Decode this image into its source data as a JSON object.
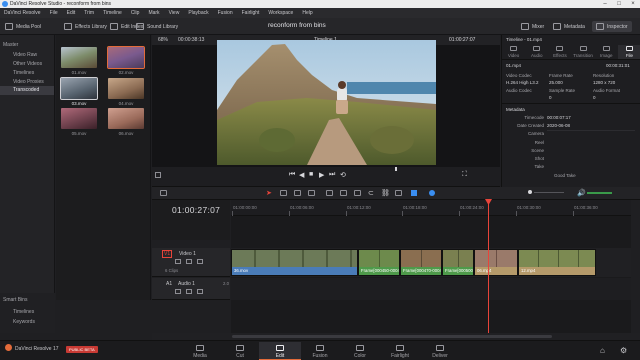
{
  "window": {
    "title": "DaVinci Resolve Studio - reconform from bins"
  },
  "menu": [
    "DaVinci Resolve",
    "File",
    "Edit",
    "Trim",
    "Timeline",
    "Clip",
    "Mark",
    "View",
    "Playback",
    "Fusion",
    "Fairlight",
    "Workspace",
    "Help"
  ],
  "toolbar": {
    "media_pool": "Media Pool",
    "effects_library": "Effects Library",
    "edit_index": "Edit Index",
    "sound_library": "Sound Library",
    "project_title": "reconform from bins",
    "mixer": "Mixer",
    "metadata": "Metadata",
    "inspector": "Inspector"
  },
  "media_pool": {
    "master": "Master",
    "bins": [
      "Video Raw",
      "Other Videos",
      "Timelines",
      "Video Proxies",
      "Transcoded"
    ],
    "selected_bin": "Transcoded",
    "smart_bins": "Smart Bins",
    "smart_items": [
      "Timelines",
      "Keywords"
    ],
    "clips": [
      {
        "name": "01.mov",
        "color": "#6e8452"
      },
      {
        "name": "02.mov",
        "color": "#7a5a8e"
      },
      {
        "name": "03.mov",
        "color": "#56626e"
      },
      {
        "name": "04.mov",
        "color": "#8a6a52"
      },
      {
        "name": "05.mov",
        "color": "#6a3e4a"
      },
      {
        "name": "06.mov",
        "color": "#9a6a5a"
      }
    ]
  },
  "viewer": {
    "zoom": "68%",
    "source_tc": "00:00:38:13",
    "timeline_name": "Timeline 1",
    "record_tc": "01:00:27:07"
  },
  "inspector": {
    "header": "Timeline - 01.mp4",
    "tabs": [
      "Video",
      "Audio",
      "Effects",
      "Transition",
      "Image",
      "File"
    ],
    "active_tab": "File",
    "clip_name": "01.mp4",
    "clip_tc": "00:00:31:01",
    "video_codec_label": "Video Codec",
    "video_codec": "H.264 High L3.2",
    "frame_rate_label": "Frame Rate",
    "frame_rate": "25.000",
    "resolution_label": "Resolution",
    "resolution": "1280 x 720",
    "audio_codec_label": "Audio Codec",
    "sample_rate_label": "Sample Rate",
    "sample_rate": "0",
    "audio_format_label": "Audio Format",
    "audio_format": "0",
    "metadata_title": "Metadata",
    "meta_rows": [
      {
        "k": "Timecode",
        "v": "00:00:07:17"
      },
      {
        "k": "Date Created",
        "v": "2020-06-08"
      },
      {
        "k": "Camera",
        "v": ""
      },
      {
        "k": "Reel",
        "v": ""
      },
      {
        "k": "Scene",
        "v": ""
      },
      {
        "k": "Shot",
        "v": ""
      },
      {
        "k": "Take",
        "v": ""
      }
    ],
    "good_take": "Good Take"
  },
  "timeline": {
    "timecode": "01:00:27:07",
    "ruler": [
      "01:00:00:00",
      "01:00:06:00",
      "01:00:12:00",
      "01:00:18:00",
      "01:00:24:00",
      "01:00:30:00",
      "01:00:36:00"
    ],
    "video_track": {
      "id": "V1",
      "name": "Video 1",
      "clips_count": "6 Clips"
    },
    "audio_track": {
      "id": "A1",
      "name": "Audio 1",
      "channels": "2.0"
    },
    "clips": [
      {
        "label": "36.mov",
        "color": "#4a7cb8",
        "thumb": "#5c6e4c"
      },
      {
        "label": "Frame[000450-000463].mov",
        "color": "#4e9a4a",
        "thumb": "#6d7a58"
      },
      {
        "label": "Frame[000470-000485].mov",
        "color": "#4e9a4a",
        "thumb": "#7a6650"
      },
      {
        "label": "Frame[000500-000...",
        "color": "#4e9a4a",
        "thumb": "#6c7450"
      },
      {
        "label": "06.mp4",
        "color": "#b59a6a",
        "thumb": "#8a6a5a"
      },
      {
        "label": "12.mp4",
        "color": "#b59a6a",
        "thumb": "#6e7c52"
      }
    ]
  },
  "pages": [
    "Media",
    "Cut",
    "Edit",
    "Fusion",
    "Color",
    "Fairlight",
    "Deliver"
  ],
  "active_page": "Edit",
  "app_version": "DaVinci Resolve 17",
  "beta_badge": "PUBLIC BETA"
}
